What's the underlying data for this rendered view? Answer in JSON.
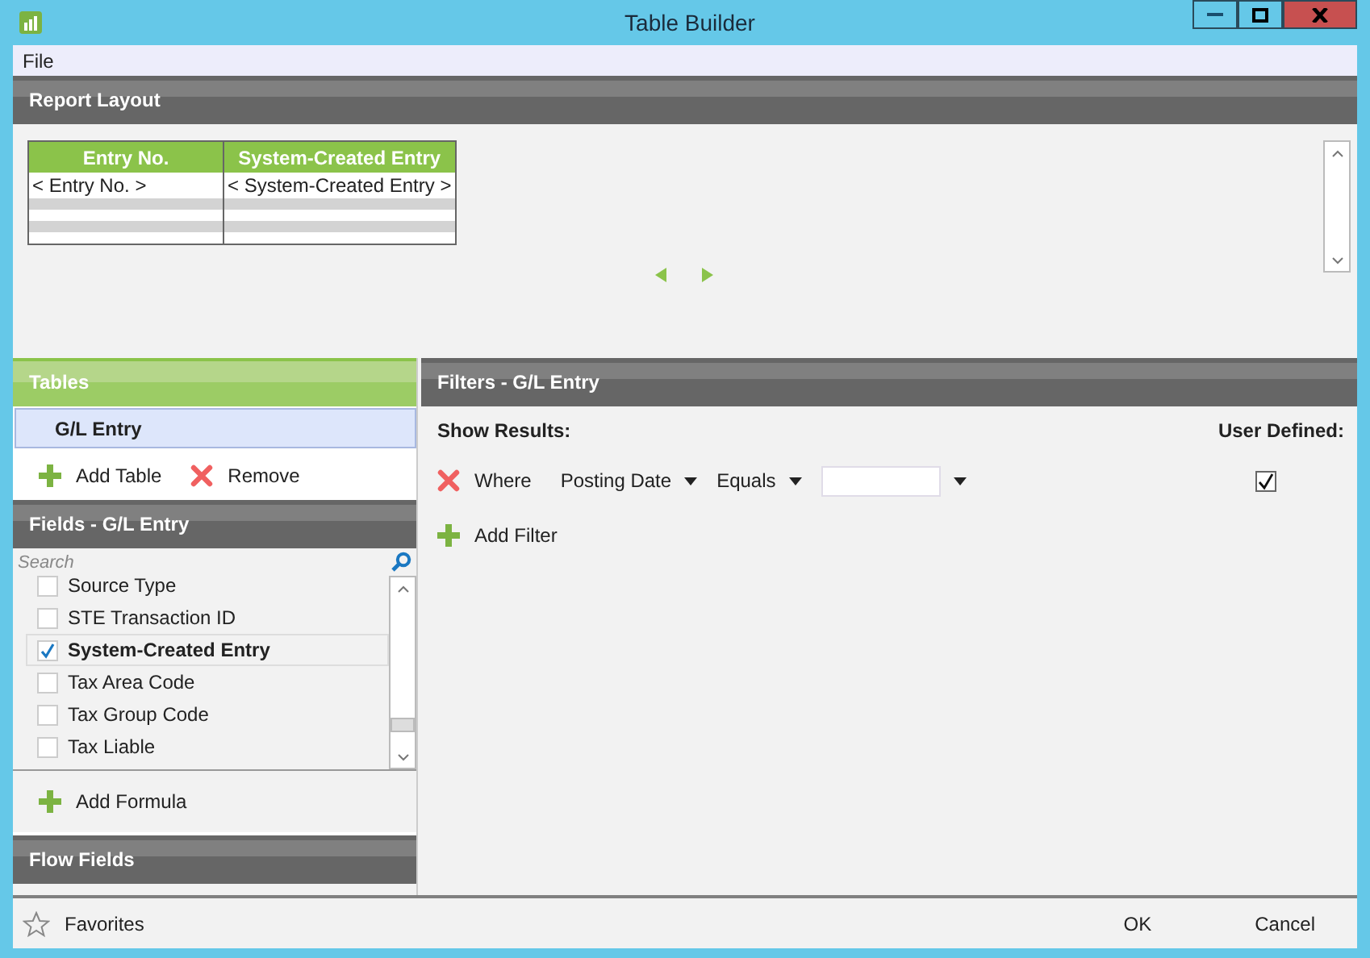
{
  "window": {
    "title": "Table Builder"
  },
  "menu": [
    "File"
  ],
  "report_layout": {
    "title": "Report Layout",
    "columns": [
      {
        "header": "Entry No.",
        "placeholder": "< Entry No. >"
      },
      {
        "header": "System-Created Entry",
        "placeholder": "< System-Created Entry >"
      }
    ]
  },
  "tables": {
    "title": "Tables",
    "items": [
      {
        "label": "G/L Entry",
        "selected": true
      }
    ],
    "actions": [
      {
        "kind": "add",
        "label": "Add Table"
      },
      {
        "kind": "remove",
        "label": "Remove"
      }
    ]
  },
  "fields": {
    "title": "Fields - G/L Entry",
    "placeholder": "Search",
    "items": [
      {
        "label": "Source Type",
        "checked": false,
        "selected": false
      },
      {
        "label": "STE Transaction ID",
        "checked": false,
        "selected": false
      },
      {
        "label": "System-Created Entry",
        "checked": true,
        "selected": true
      },
      {
        "label": "Tax Area Code",
        "checked": false,
        "selected": false
      },
      {
        "label": "Tax Group Code",
        "checked": false,
        "selected": false
      },
      {
        "label": "Tax Liable",
        "checked": false,
        "selected": false
      }
    ],
    "add_formula": "Add Formula"
  },
  "flow_fields": {
    "title": "Flow Fields"
  },
  "filters": {
    "title": "Filters - G/L Entry",
    "show_results": "Show Results:",
    "user_defined": "User Defined:",
    "rows": [
      {
        "where": "Where",
        "field": "Posting Date",
        "operator": "Equals",
        "user_defined": true
      }
    ],
    "add_filter": "Add Filter"
  },
  "footer": {
    "favorites": "Favorites",
    "buttons": [
      "OK",
      "Cancel"
    ]
  }
}
